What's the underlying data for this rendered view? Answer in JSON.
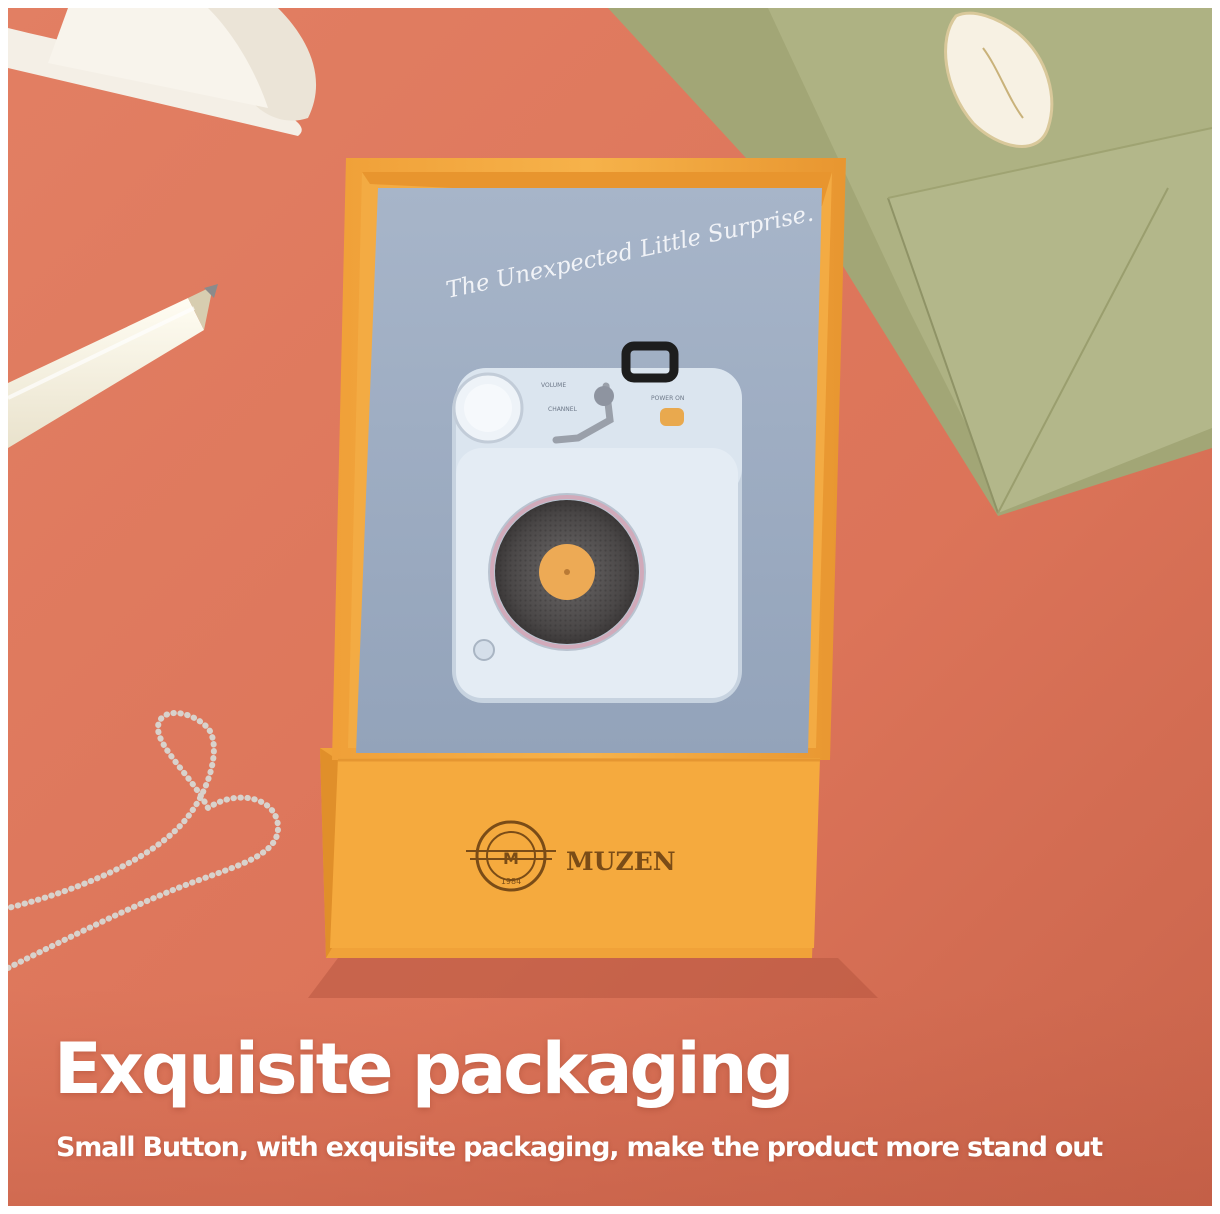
{
  "photo": {
    "tagline_script": "The Unexpected Little Surprise.",
    "brand_name": "MUZEN",
    "logo_year": "1984",
    "device_labels": {
      "volume": "VOLUME",
      "channel": "CHANNEL",
      "power": "POWER ON"
    }
  },
  "caption": {
    "headline": "Exquisite packaging",
    "subline": "Small Button, with exquisite packaging, make the product more stand out"
  },
  "colors": {
    "background": "#e0795e",
    "box_orange": "#f2a53a",
    "insert_blue": "#9faec4",
    "device_blue": "#dfe8f1",
    "envelope_green": "#a9ad7f",
    "caption_text": "#ffffff"
  }
}
